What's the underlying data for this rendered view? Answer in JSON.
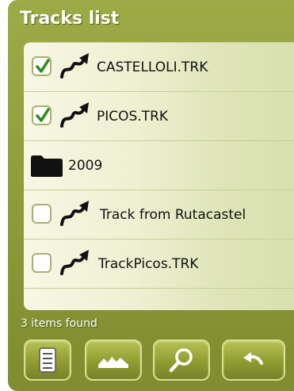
{
  "title": "Tracks list",
  "rows": [
    {
      "kind": "track",
      "checked": true,
      "label": "CASTELLOLI.TRK",
      "icon": "track-route-icon"
    },
    {
      "kind": "track",
      "checked": true,
      "label": "PICOS.TRK",
      "icon": "track-route-icon"
    },
    {
      "kind": "folder",
      "checked": null,
      "label": "2009",
      "icon": "folder-icon"
    },
    {
      "kind": "track",
      "checked": false,
      "label": "Track from Rutacastel",
      "icon": "track-route-icon"
    },
    {
      "kind": "track",
      "checked": false,
      "label": "TrackPicos.TRK",
      "icon": "track-route-icon"
    }
  ],
  "status": "3 items found",
  "toolbar": [
    {
      "name": "track-details-button",
      "icon": "list-details-icon"
    },
    {
      "name": "altitude-profile-button",
      "icon": "mountain-profile-icon"
    },
    {
      "name": "search-button",
      "icon": "magnifier-icon"
    },
    {
      "name": "back-button",
      "icon": "undo-arrow-icon"
    }
  ],
  "colors": {
    "frame": "#8e9c3a",
    "list_bg": "#f7f7e4",
    "check": "#2e8b1e"
  }
}
